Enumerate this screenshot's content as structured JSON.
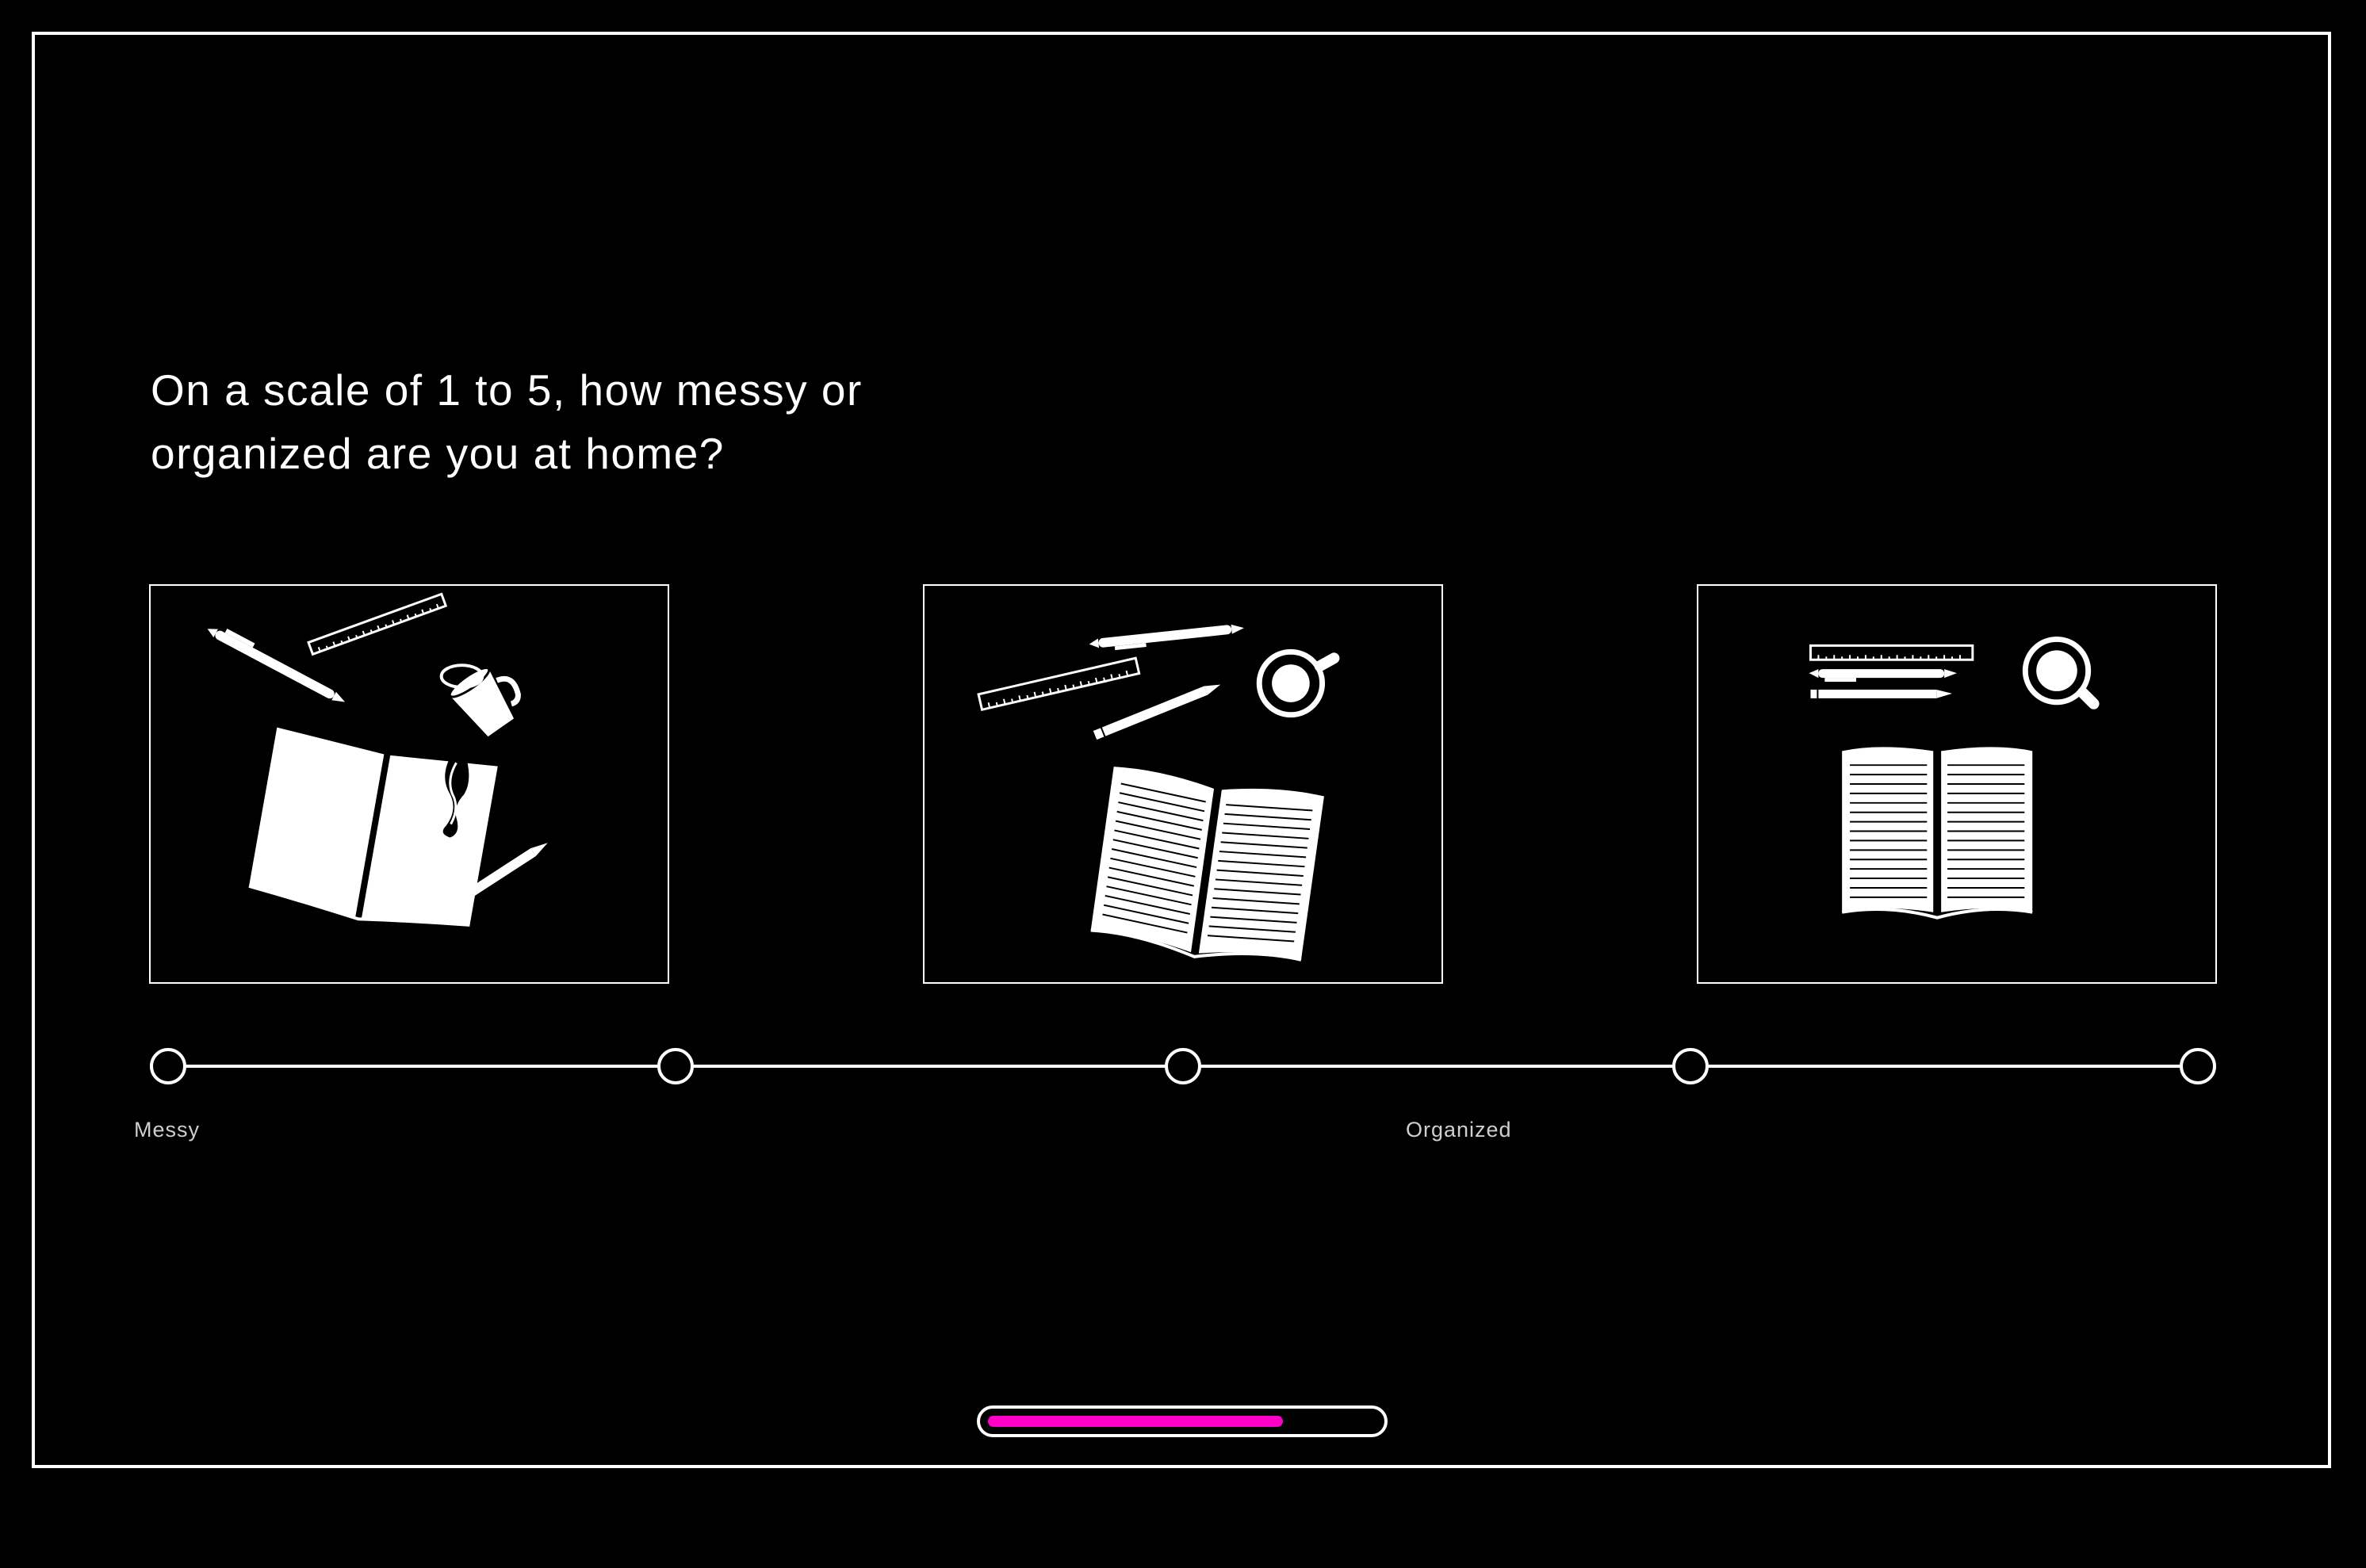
{
  "question": {
    "text": "On a scale of 1 to 5, how messy or organized are you at home?"
  },
  "illustrations": [
    {
      "icon": "messy-desk-icon"
    },
    {
      "icon": "semi-organized-desk-icon"
    },
    {
      "icon": "organized-desk-icon"
    }
  ],
  "scale": {
    "options": [
      1,
      2,
      3,
      4,
      5
    ],
    "min_label": "Messy",
    "max_label": "Organized"
  },
  "progress": {
    "fraction": 0.76,
    "fill_color": "#ff00c8"
  },
  "colors": {
    "background": "#000000",
    "foreground": "#ffffff",
    "accent": "#ff00c8"
  }
}
